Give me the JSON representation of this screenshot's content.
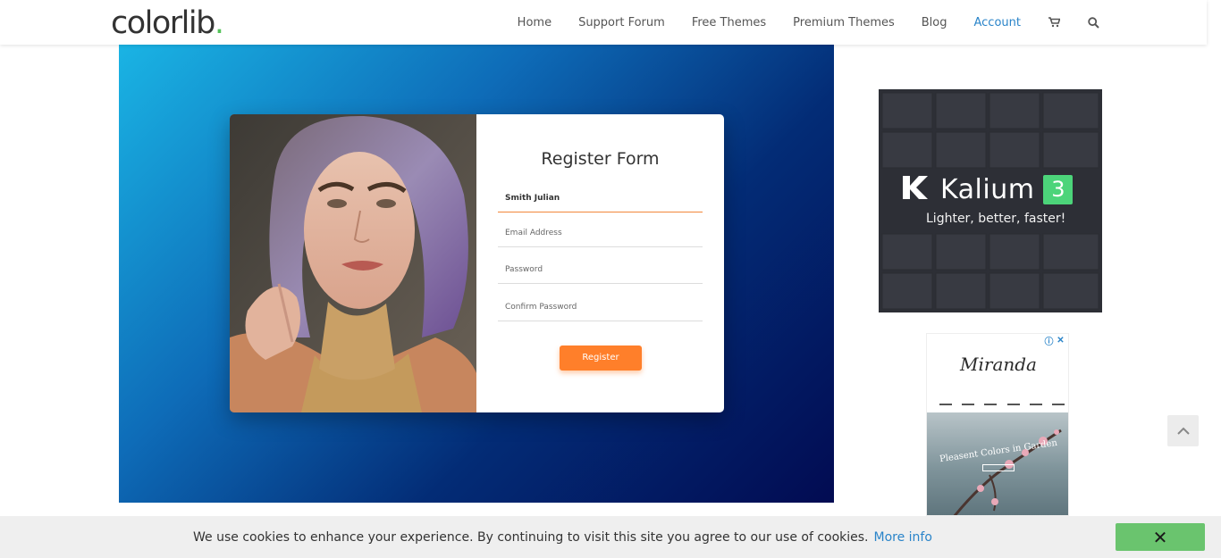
{
  "header": {
    "logo": {
      "text": "colorlib",
      "dot": "."
    },
    "nav": [
      {
        "label": "Home"
      },
      {
        "label": "Support Forum"
      },
      {
        "label": "Free Themes"
      },
      {
        "label": "Premium Themes"
      },
      {
        "label": "Blog"
      },
      {
        "label": "Account",
        "active": true
      }
    ],
    "icons": [
      "cart-icon",
      "search-icon"
    ]
  },
  "demo": {
    "form_title": "Register Form",
    "fields": [
      {
        "value": "Smith Julian",
        "filled": true
      },
      {
        "placeholder": "Email Address"
      },
      {
        "placeholder": "Password"
      },
      {
        "placeholder": "Confirm Password"
      }
    ],
    "button": "Register"
  },
  "ads": {
    "kalium": {
      "name": "Kalium",
      "version": "3",
      "tagline": "Lighter, better, faster!"
    },
    "miranda": {
      "title": "Miranda",
      "headline": "Pleasent Colors in Garden",
      "adchoices": [
        "info-icon",
        "close-icon"
      ]
    }
  },
  "cookie": {
    "message": "We use cookies to enhance your experience. By continuing to visit this site you agree to our use of cookies.",
    "link": "More info",
    "close_label": "✕"
  },
  "colors": {
    "brand_green": "#55c35a",
    "link_blue": "#2a84c9",
    "register_orange": "#ff7f2a",
    "kalium_badge": "#4cd47a"
  }
}
